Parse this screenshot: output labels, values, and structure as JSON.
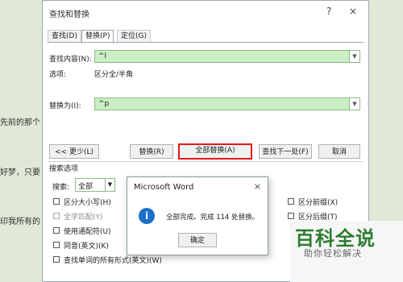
{
  "background": {
    "lines": [
      "先前的那个",
      "好梦，只要",
      "印我所有的"
    ]
  },
  "dialog": {
    "title": "查找和替换",
    "help": "?",
    "close": "×",
    "tabs": [
      {
        "label": "查找(D)"
      },
      {
        "label": "替换(P)",
        "active": true
      },
      {
        "label": "定位(G)"
      }
    ],
    "find_label": "查找内容(N):",
    "find_value": "^l",
    "options_label": "选项:",
    "options_value": "区分全/半角",
    "replace_label": "替换为(I):",
    "replace_value": "^p",
    "buttons": {
      "less": "<< 更少(L)",
      "replace": "替换(R)",
      "replace_all": "全部替换(A)",
      "find_next": "查找下一处(F)",
      "cancel": "取消"
    },
    "search_options_title": "搜索选项",
    "search_label": "搜索:",
    "search_value": "全部",
    "checkboxes_left": [
      {
        "label": "区分大小写(H)",
        "disabled": false
      },
      {
        "label": "全字匹配(Y)",
        "disabled": true
      },
      {
        "label": "使用通配符(U)",
        "disabled": false
      },
      {
        "label": "同音(英文)(K)",
        "disabled": false
      },
      {
        "label": "查找单词的所有形式(英文)(W)",
        "disabled": false
      }
    ],
    "checkboxes_right": [
      {
        "label": "区分前缀(X)"
      },
      {
        "label": "区分后缀(T)"
      }
    ]
  },
  "message_box": {
    "title": "Microsoft Word",
    "close": "×",
    "icon": "info-icon",
    "text": "全部完成。完成 114 处替换。",
    "ok": "确定"
  },
  "watermark": {
    "title": "百科全说",
    "subtitle": "助你轻松解决"
  },
  "colors": {
    "field_bg": "#cbeec5",
    "highlight": "#e0181a",
    "info_icon": "#1a6fc9",
    "watermark": "#2e7d32"
  }
}
